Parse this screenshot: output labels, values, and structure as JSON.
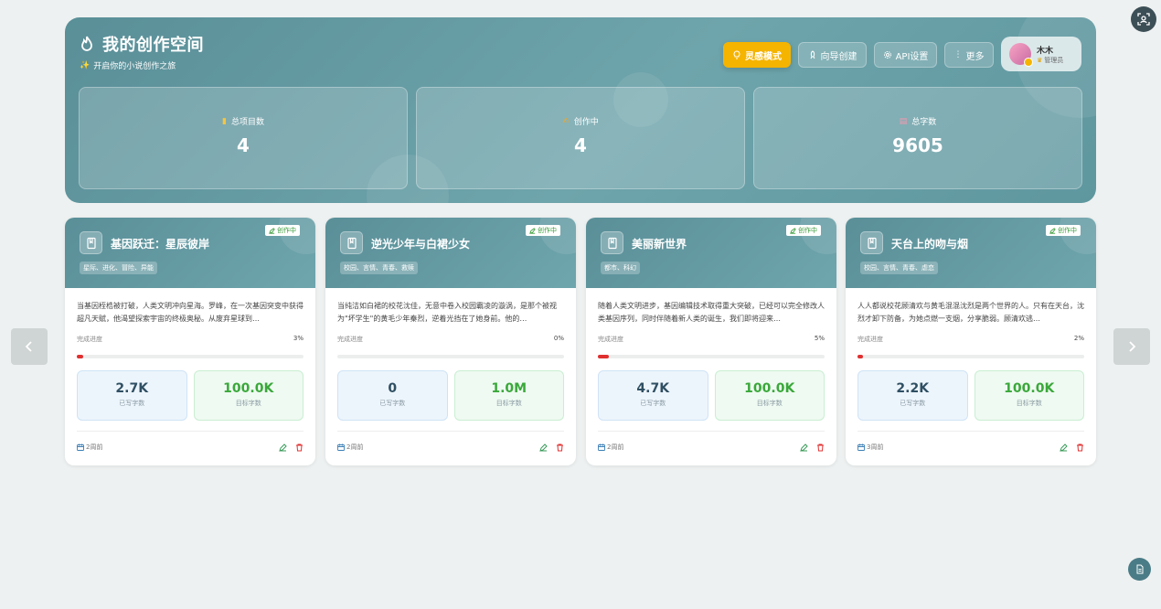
{
  "header": {
    "title": "我的创作空间",
    "subtitle": "开启你的小说创作之旅",
    "subtitle_icon": "sparkles-emoji",
    "buttons": {
      "inspiration": "灵感模式",
      "wizard": "向导创建",
      "api": "API设置",
      "more": "更多"
    },
    "user": {
      "name": "木木",
      "role": "管理员"
    }
  },
  "stats": [
    {
      "label": "总项目数",
      "value": "4",
      "icon": "books-icon"
    },
    {
      "label": "创作中",
      "value": "4",
      "icon": "writing-hand-icon"
    },
    {
      "label": "总字数",
      "value": "9605",
      "icon": "memo-icon"
    }
  ],
  "cards": [
    {
      "title": "基因跃迁：星辰彼岸",
      "status": "创作中",
      "tags": "星际、进化、冒险、异能",
      "description": "当基因桎梏被打破，人类文明冲向星海。罗峰，在一次基因突变中获得超凡天赋，他渴望探索宇宙的终极奥秘。从废弃星球到…",
      "progress_label": "完成进度",
      "progress_text": "3%",
      "progress": 0.03,
      "written": "2.7K",
      "written_label": "已写字数",
      "target": "100.0K",
      "target_label": "目标字数",
      "date": "2周前"
    },
    {
      "title": "逆光少年与白裙少女",
      "status": "创作中",
      "tags": "校园、言情、青春、救赎",
      "description": "当纯洁如白裙的校花沈佳，无意中卷入校园霸凌的漩涡，是那个被视为\"坏学生\"的黄毛少年秦烈，逆着光挡在了她身前。他的…",
      "progress_label": "完成进度",
      "progress_text": "0%",
      "progress": 0.0,
      "written": "0",
      "written_label": "已写字数",
      "target": "1.0M",
      "target_label": "目标字数",
      "date": "2周前"
    },
    {
      "title": "美丽新世界",
      "status": "创作中",
      "tags": "都市、科幻",
      "description": "随着人类文明进步，基因编辑技术取得重大突破，已经可以完全修改人类基因序列，同时伴随着新人类的诞生，我们即将迎来…",
      "progress_label": "完成进度",
      "progress_text": "5%",
      "progress": 0.05,
      "written": "4.7K",
      "written_label": "已写字数",
      "target": "100.0K",
      "target_label": "目标字数",
      "date": "2周前"
    },
    {
      "title": "天台上的吻与烟",
      "status": "创作中",
      "tags": "校园、言情、青春、虐恋",
      "description": "人人都说校花顾清欢与黄毛混混沈烈是两个世界的人。只有在天台，沈烈才卸下防备，为她点燃一支烟，分享脆弱。顾清欢逃…",
      "progress_label": "完成进度",
      "progress_text": "2%",
      "progress": 0.02,
      "written": "2.2K",
      "written_label": "已写字数",
      "target": "100.0K",
      "target_label": "目标字数",
      "date": "3周前"
    }
  ],
  "colors": {
    "accent": "#5a8f98",
    "gold": "#f5b400",
    "danger": "#e03030",
    "green": "#3aa83a"
  }
}
